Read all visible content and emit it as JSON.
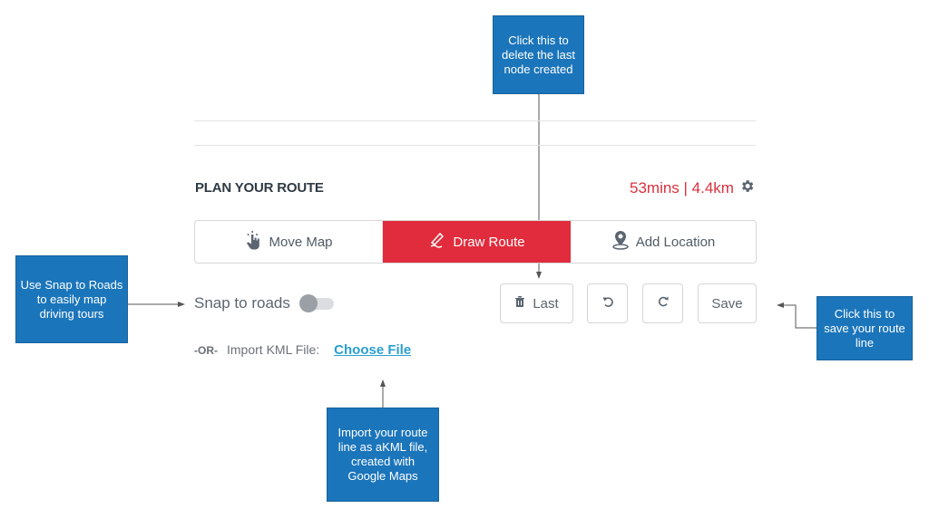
{
  "callouts": {
    "delete_last": "Click this to delete the last node created",
    "snap_roads": "Use Snap to Roads to easily map driving tours",
    "save_route": "Click this to save your route line",
    "import_kml": "Import your route line as aKML file, created with Google Maps"
  },
  "panel": {
    "title": "PLAN YOUR ROUTE",
    "stats": "53mins | 4.4km",
    "settings_icon": "gear-icon",
    "modes": [
      {
        "label": "Move Map",
        "icon": "hand-pointer-icon",
        "active": false
      },
      {
        "label": "Draw Route",
        "icon": "pencil-draw-icon",
        "active": true
      },
      {
        "label": "Add Location",
        "icon": "map-pin-icon",
        "active": false
      }
    ],
    "snap_label": "Snap to roads",
    "snap_enabled": false,
    "buttons": {
      "last_label": "Last",
      "last_icon": "trash-icon",
      "undo_icon": "undo-icon",
      "redo_icon": "redo-icon",
      "save_label": "Save"
    },
    "kml": {
      "or_label": "-OR-",
      "import_label": "Import KML File:",
      "choose_label": "Choose File"
    }
  },
  "colors": {
    "accent_red": "#e02c3c",
    "callout_blue": "#1b75bb",
    "link_blue": "#2a9fd0"
  }
}
